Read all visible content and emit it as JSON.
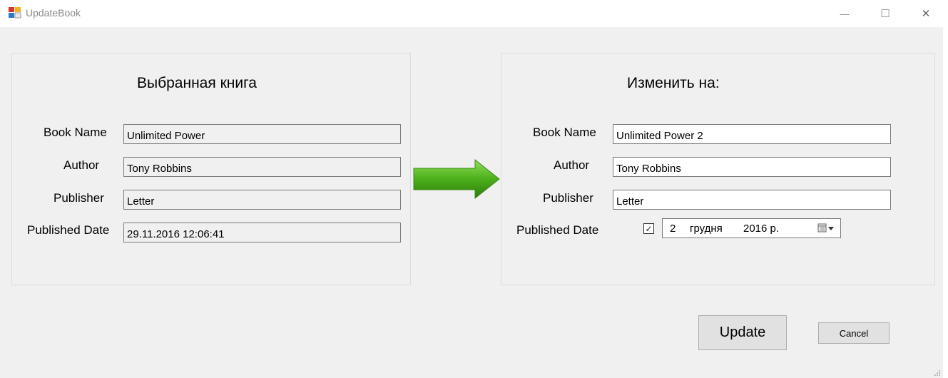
{
  "window": {
    "title": "UpdateBook",
    "minimize_symbol": "—",
    "maximize_symbol": "☐",
    "close_symbol": "✕"
  },
  "left_panel": {
    "title": "Выбранная книга",
    "fields": [
      {
        "label": "Book Name",
        "value": "Unlimited Power"
      },
      {
        "label": "Author",
        "value": "Tony Robbins"
      },
      {
        "label": "Publisher",
        "value": "Letter"
      },
      {
        "label": "Published Date",
        "value": "29.11.2016 12:06:41"
      }
    ]
  },
  "arrow": {
    "icon": "arrow-right-icon",
    "color": "#4caf1a"
  },
  "right_panel": {
    "title": "Изменить на:",
    "fields": [
      {
        "label": "Book Name",
        "value": "Unlimited Power 2"
      },
      {
        "label": "Author",
        "value": "Tony Robbins"
      },
      {
        "label": "Publisher",
        "value": "Letter"
      },
      {
        "label": "Published Date"
      }
    ],
    "date_picker": {
      "checked": true,
      "check_symbol": "✓",
      "day": "2",
      "month": "грудня",
      "year": "2016 р.",
      "icon": "calendar-dropdown-icon"
    }
  },
  "buttons": {
    "update": "Update",
    "cancel": "Cancel"
  }
}
